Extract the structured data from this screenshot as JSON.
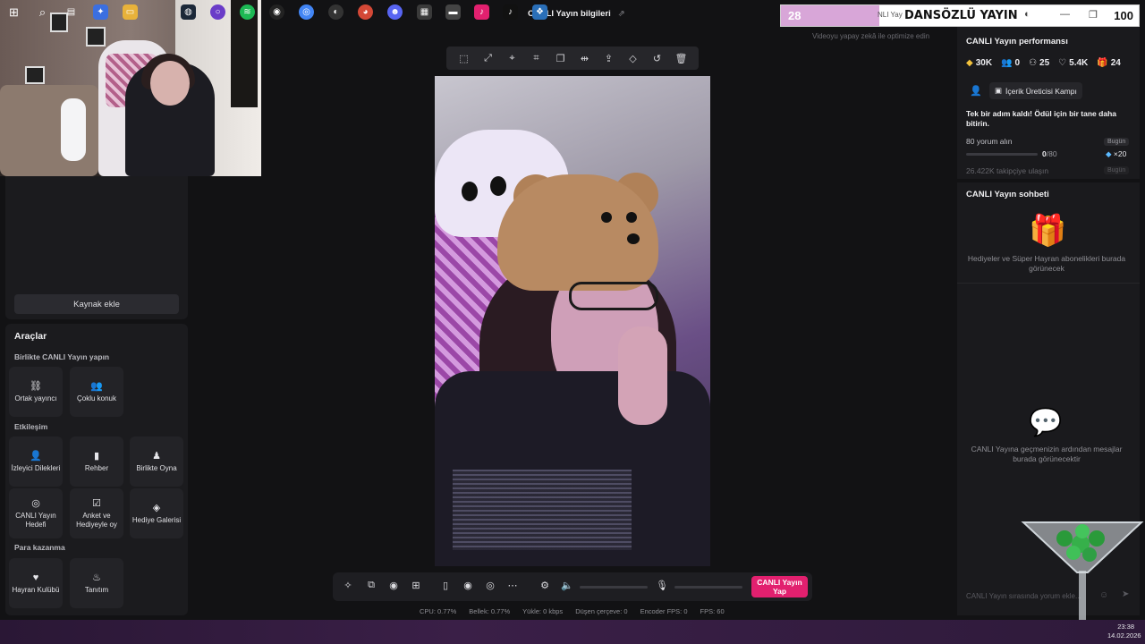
{
  "window": {
    "title": "CANLI Yayın bilgileri",
    "ai_hint": "Videoyu yapay zekâ ile optimize edin"
  },
  "left_panel": {
    "add_source_label": "Kaynak ekle",
    "tools_title": "Araçlar",
    "sections": [
      {
        "title": "Birlikte CANLI Yayın yapın",
        "items": [
          {
            "label": "Ortak yayıncı",
            "icon": "link-icon"
          },
          {
            "label": "Çoklu konuk",
            "icon": "users-icon"
          }
        ]
      },
      {
        "title": "Etkileşim",
        "items": [
          {
            "label": "İzleyici Dilekleri",
            "icon": "audience-icon"
          },
          {
            "label": "Rehber",
            "icon": "guide-icon"
          },
          {
            "label": "Birlikte Oyna",
            "icon": "play-together-icon"
          },
          {
            "label": "CANLI Yayın Hedefi",
            "icon": "target-icon"
          },
          {
            "label": "Anket ve Hediyeyle oy",
            "icon": "poll-icon"
          },
          {
            "label": "Hediye Galerisi",
            "icon": "gift-gallery-icon"
          }
        ]
      },
      {
        "title": "Para kazanma",
        "items": [
          {
            "label": "Hayran Kulübü",
            "icon": "heart-icon"
          },
          {
            "label": "Tanıtım",
            "icon": "flame-icon"
          }
        ]
      }
    ]
  },
  "bottom_bar": {
    "go_live_label": "CANLI Yayın Yap",
    "stats": {
      "cpu": "CPU: 0.77%",
      "memory": "Bellek: 0.77%",
      "upload": "Yükle: 0 kbps",
      "dropped_frames": "Düşen çerçeve: 0",
      "encoder_fps": "Encoder FPS: 0",
      "fps": "FPS: 60"
    }
  },
  "right_panel": {
    "performance_title": "CANLI Yayın performansı",
    "metrics": [
      {
        "icon": "coin-icon",
        "value": "30K"
      },
      {
        "icon": "viewers-icon",
        "value": "0"
      },
      {
        "icon": "followers-icon",
        "value": "25"
      },
      {
        "icon": "heart-icon",
        "value": "5.4K"
      },
      {
        "icon": "gift-icon",
        "value": "24"
      }
    ],
    "creator_camp_label": "İçerik Üreticisi Kampı",
    "step_text": "Tek bir adım kaldı! Ödül için bir tane daha bitirin.",
    "task1_label": "80 yorum alın",
    "task1_badge": "Bugün",
    "task1_progress": "0",
    "task1_total": "/80",
    "task1_progress_fraction": 0,
    "task1_reward": "×20",
    "task2_label": "26.422K takipçiye ulaşın",
    "task2_badge": "Bugün",
    "chat_title": "CANLI Yayın sohbeti",
    "gifts_empty": "Hediyeler ve Süper Hayran abonelikleri burada görünecek",
    "chat_empty": "CANLI Yayına geçmenizin ardından mesajlar burada görünecektir",
    "chat_placeholder": "CANLI Yayın sırasında yorum ekle..."
  },
  "overlay": {
    "left_value": "28",
    "label": "DANSÖZLÜ YAYIN",
    "under_text": "NLI Yay",
    "right_value": "100",
    "fill_fraction": 0.28
  },
  "taskbar": {
    "time": "23:38",
    "date": "14.02.2026"
  },
  "colors": {
    "accent": "#e2206f",
    "overlay_fill": "#d8a6d8",
    "background": "#121214",
    "panel": "#1b1b1e"
  }
}
